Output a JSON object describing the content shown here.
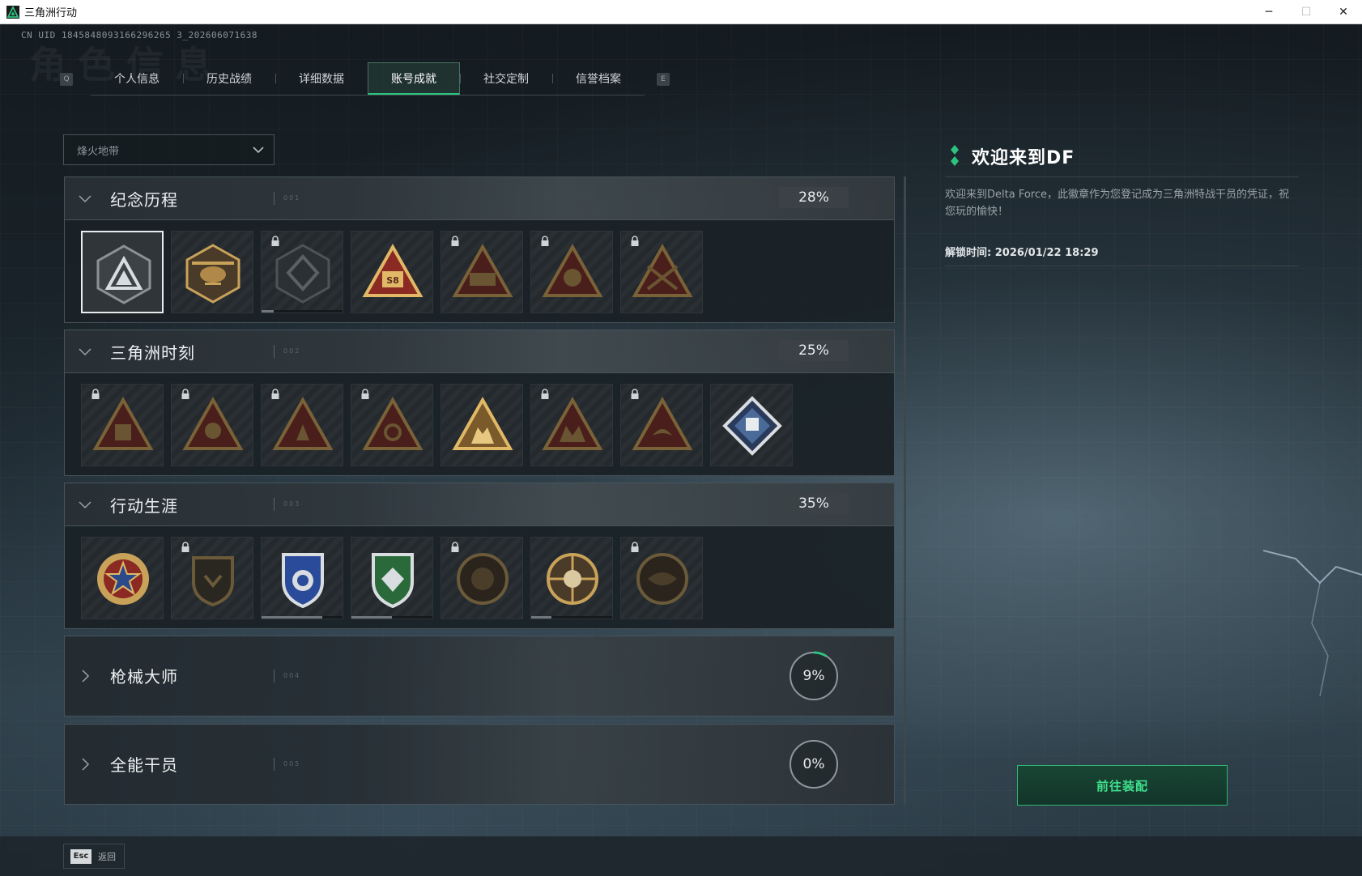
{
  "window": {
    "title": "三角洲行动",
    "controls": {
      "minimize": "─",
      "maximize": "☐",
      "close": "✕"
    }
  },
  "uid_text": "CN UID 1845848093166296265 3_202606071638",
  "watermark_text": "角色信息",
  "tabs": {
    "left_key": "Q",
    "right_key": "E",
    "items": [
      {
        "label": "个人信息",
        "active": false
      },
      {
        "label": "历史战绩",
        "active": false
      },
      {
        "label": "详细数据",
        "active": false
      },
      {
        "label": "账号成就",
        "active": true
      },
      {
        "label": "社交定制",
        "active": false
      },
      {
        "label": "信誉档案",
        "active": false
      }
    ]
  },
  "mode_select": {
    "value": "烽火地带",
    "icon": "chevron-down-icon"
  },
  "categories": [
    {
      "name": "纪念历程",
      "percent": "28%",
      "expanded": true,
      "dots": "001"
    },
    {
      "name": "三角洲时刻",
      "percent": "25%",
      "expanded": true,
      "dots": "002"
    },
    {
      "name": "行动生涯",
      "percent": "35%",
      "expanded": true,
      "dots": "003"
    },
    {
      "name": "枪械大师",
      "percent": "9%",
      "progress": 0.09,
      "expanded": false,
      "dots": "004"
    },
    {
      "name": "全能干员",
      "percent": "0%",
      "progress": 0.0,
      "expanded": false,
      "dots": "005"
    }
  ],
  "badges": {
    "memorial": [
      {
        "icon": "delta-triangle-badge-icon",
        "locked": false,
        "selected": true
      },
      {
        "icon": "helicopter-badge-icon",
        "locked": false
      },
      {
        "icon": "shield-emblem-badge-icon",
        "locked": true,
        "progress": 0.15
      },
      {
        "icon": "s8-season-badge-icon",
        "locked": false
      },
      {
        "icon": "armored-vehicle-badge-icon",
        "locked": true
      },
      {
        "icon": "operator-helmet-badge-icon",
        "locked": true
      },
      {
        "icon": "crossed-rifles-badge-icon",
        "locked": true
      }
    ],
    "moments": [
      {
        "icon": "backpack-badge-icon",
        "locked": true
      },
      {
        "icon": "soldier-badge-icon",
        "locked": true
      },
      {
        "icon": "kneeling-soldier-badge-icon",
        "locked": true
      },
      {
        "icon": "hands-gear-badge-icon",
        "locked": true
      },
      {
        "icon": "squad-badge-icon",
        "locked": false
      },
      {
        "icon": "team-group-badge-icon",
        "locked": true
      },
      {
        "icon": "bird-badge-icon",
        "locked": true
      },
      {
        "icon": "fist-diamond-badge-icon",
        "locked": false
      }
    ],
    "career": [
      {
        "icon": "star-medal-badge-icon",
        "locked": false
      },
      {
        "icon": "dark-shield-badge-icon",
        "locked": true
      },
      {
        "icon": "blue-police-shield-badge-icon",
        "locked": false,
        "progress": 0.75
      },
      {
        "icon": "green-shield-badge-icon",
        "locked": false,
        "progress": 0.5
      },
      {
        "icon": "bronze-round-badge-icon",
        "locked": true
      },
      {
        "icon": "skull-target-badge-icon",
        "locked": false,
        "progress": 0.25
      },
      {
        "icon": "eye-round-badge-icon",
        "locked": true
      }
    ]
  },
  "detail": {
    "title": "欢迎来到DF",
    "description": "欢迎来到Delta Force，此徽章作为您登记成为三角洲特战干员的凭证，祝您玩的愉快！",
    "unlock_label": "解锁时间: 2026/01/22 18:29",
    "equip_button": "前往装配"
  },
  "footer": {
    "esc_key": "Esc",
    "back_label": "返回"
  },
  "colors": {
    "accent_green": "#2ec27e",
    "badge_gold": "#c9a25a",
    "badge_dark_red": "#8a2a22"
  }
}
